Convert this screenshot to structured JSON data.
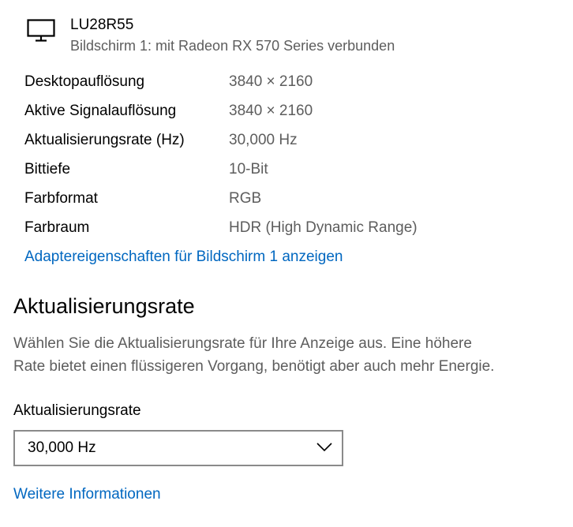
{
  "monitor": {
    "icon": "monitor-icon",
    "name": "LU28R55",
    "subtitle": "Bildschirm 1: mit Radeon RX 570 Series verbunden"
  },
  "properties": [
    {
      "label": "Desktopauflösung",
      "value": "3840 × 2160"
    },
    {
      "label": "Aktive Signalauflösung",
      "value": "3840 × 2160"
    },
    {
      "label": "Aktualisierungsrate (Hz)",
      "value": "30,000 Hz"
    },
    {
      "label": "Bittiefe",
      "value": "10-Bit"
    },
    {
      "label": "Farbformat",
      "value": "RGB"
    },
    {
      "label": "Farbraum",
      "value": "HDR (High Dynamic Range)"
    }
  ],
  "adapter_link": "Adaptereigenschaften für Bildschirm 1 anzeigen",
  "refresh_section": {
    "title": "Aktualisierungsrate",
    "description_line1": "Wählen Sie die Aktualisierungsrate für Ihre Anzeige aus. Eine höhere",
    "description_line2": "Rate bietet einen flüssigeren Vorgang, benötigt aber auch mehr Energie.",
    "field_label": "Aktualisierungsrate",
    "selected_value": "30,000 Hz",
    "chevron_icon": "chevron-down-icon",
    "more_info_link": "Weitere Informationen"
  },
  "colors": {
    "link": "#0067c0",
    "secondary_text": "#5d5d5d",
    "dropdown_border": "#8a8a8a"
  }
}
